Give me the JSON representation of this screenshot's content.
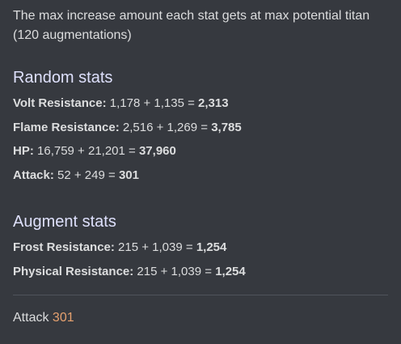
{
  "intro": "The max increase amount each stat gets at max potential titan (120 augmentations)",
  "random": {
    "heading": "Random stats",
    "stats": [
      {
        "label": "Volt Resistance:",
        "expr": "1,178 + 1,135 =",
        "total": "2,313"
      },
      {
        "label": "Flame Resistance:",
        "expr": "2,516 + 1,269 =",
        "total": "3,785"
      },
      {
        "label": "HP:",
        "expr": "16,759 + 21,201 =",
        "total": "37,960"
      },
      {
        "label": "Attack:",
        "expr": "52 + 249 =",
        "total": "301"
      }
    ]
  },
  "augment": {
    "heading": "Augment stats",
    "stats": [
      {
        "label": "Frost Resistance:",
        "expr": "215 + 1,039 =",
        "total": "1,254"
      },
      {
        "label": "Physical Resistance:",
        "expr": "215 + 1,039 =",
        "total": "1,254"
      }
    ]
  },
  "footer": {
    "label": "Attack",
    "value": "301",
    "value_color": "#e6a16f"
  }
}
